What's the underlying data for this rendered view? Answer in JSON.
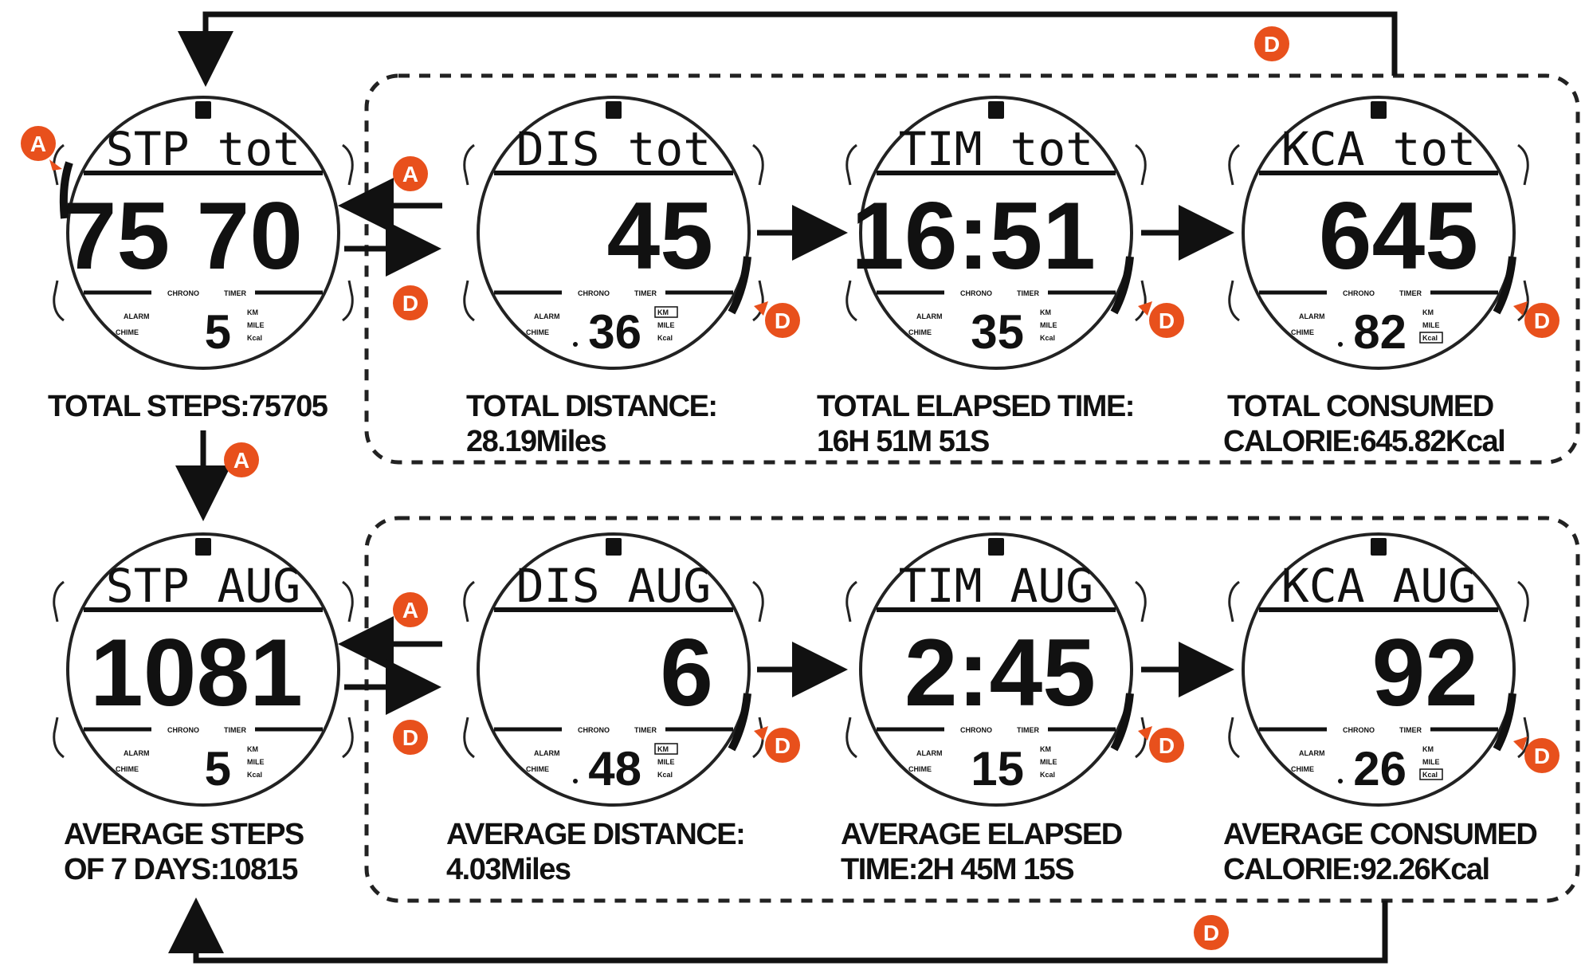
{
  "buttons": {
    "a": "A",
    "d": "D"
  },
  "colors": {
    "badge": "#e8501c",
    "ink": "#111111",
    "frame": "#222222"
  },
  "watches": [
    {
      "id": "stp-tot",
      "top": "STP tot",
      "main": "75 70",
      "small": "5",
      "dot": false,
      "unit_box": "",
      "sub_left_1": "ALARM",
      "sub_left_2": "CHIME",
      "sub_right": [
        "KM",
        "MILE",
        "Kcal"
      ],
      "chrono": "CHRONO",
      "timer": "TIMER"
    },
    {
      "id": "dis-tot",
      "top": "DIS tot",
      "main": "45",
      "small": "36",
      "dot": true,
      "unit_box": "KM",
      "sub_left_1": "ALARM",
      "sub_left_2": "CHIME",
      "sub_right": [
        "KM",
        "MILE",
        "Kcal"
      ],
      "chrono": "CHRONO",
      "timer": "TIMER"
    },
    {
      "id": "tim-tot",
      "top": "TIM tot",
      "main": "16:51",
      "small": "35",
      "dot": false,
      "unit_box": "",
      "sub_left_1": "ALARM",
      "sub_left_2": "CHIME",
      "sub_right": [
        "KM",
        "MILE",
        "Kcal"
      ],
      "chrono": "CHRONO",
      "timer": "TIMER"
    },
    {
      "id": "kca-tot",
      "top": "KCA tot",
      "main": "645",
      "small": "82",
      "dot": true,
      "unit_box": "Kcal",
      "sub_left_1": "ALARM",
      "sub_left_2": "CHIME",
      "sub_right": [
        "KM",
        "MILE",
        "Kcal"
      ],
      "chrono": "CHRONO",
      "timer": "TIMER"
    },
    {
      "id": "stp-avg",
      "top": "STP AUG",
      "main": "1081",
      "small": "5",
      "dot": false,
      "unit_box": "",
      "sub_left_1": "ALARM",
      "sub_left_2": "CHIME",
      "sub_right": [
        "KM",
        "MILE",
        "Kcal"
      ],
      "chrono": "CHRONO",
      "timer": "TIMER"
    },
    {
      "id": "dis-avg",
      "top": "DIS AUG",
      "main": "6",
      "small": "48",
      "dot": true,
      "unit_box": "KM",
      "sub_left_1": "ALARM",
      "sub_left_2": "CHIME",
      "sub_right": [
        "KM",
        "MILE",
        "Kcal"
      ],
      "chrono": "CHRONO",
      "timer": "TIMER"
    },
    {
      "id": "tim-avg",
      "top": "TIM AUG",
      "main": "2:45",
      "small": "15",
      "dot": false,
      "unit_box": "",
      "sub_left_1": "ALARM",
      "sub_left_2": "CHIME",
      "sub_right": [
        "KM",
        "MILE",
        "Kcal"
      ],
      "chrono": "CHRONO",
      "timer": "TIMER"
    },
    {
      "id": "kca-avg",
      "top": "KCA AUG",
      "main": "92",
      "small": "26",
      "dot": true,
      "unit_box": "Kcal",
      "sub_left_1": "ALARM",
      "sub_left_2": "CHIME",
      "sub_right": [
        "KM",
        "MILE",
        "Kcal"
      ],
      "chrono": "CHRONO",
      "timer": "TIMER"
    }
  ],
  "captions": {
    "total_steps": [
      "TOTAL STEPS:75705"
    ],
    "total_distance": [
      "TOTAL  DISTANCE:",
      "28.19Miles"
    ],
    "total_time": [
      "TOTAL ELAPSED TIME:",
      "16H 51M 51S"
    ],
    "total_calorie": [
      "TOTAL CONSUMED",
      "CALORIE:645.82Kcal"
    ],
    "avg_steps": [
      "AVERAGE STEPS",
      "OF 7 DAYS:10815"
    ],
    "avg_distance": [
      "AVERAGE DISTANCE:",
      "4.03Miles"
    ],
    "avg_time": [
      "AVERAGE ELAPSED",
      "TIME:2H 45M 15S"
    ],
    "avg_calorie": [
      "AVERAGE CONSUMED",
      "CALORIE:92.26Kcal"
    ]
  }
}
